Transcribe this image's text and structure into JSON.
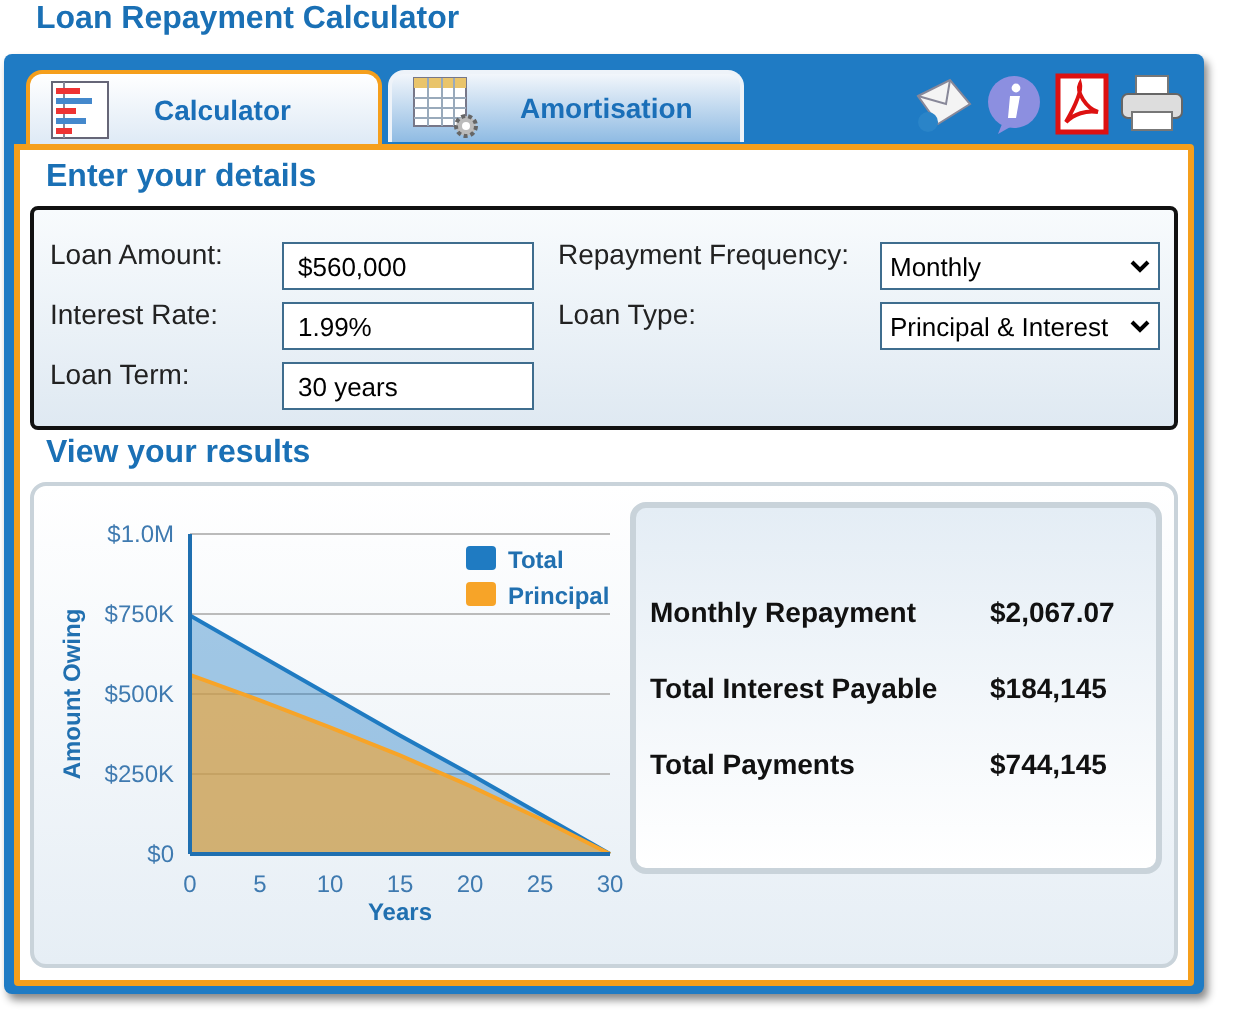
{
  "title": "Loan Repayment Calculator",
  "tabs": [
    {
      "label": "Calculator",
      "selected": true,
      "kind": "calculator"
    },
    {
      "label": "Amortisation",
      "selected": false,
      "kind": "schedule"
    }
  ],
  "details": {
    "heading": "Enter your details",
    "fields": [
      {
        "label": "Loan Amount:",
        "value": "$560,000"
      },
      {
        "label": "Interest Rate:",
        "value": "1.99%"
      },
      {
        "label": "Loan Term:",
        "value": "30 years"
      }
    ],
    "selects": [
      {
        "label": "Repayment Frequency:",
        "value": "Monthly"
      },
      {
        "label": "Loan Type:",
        "value": "Principal & Interest"
      }
    ]
  },
  "results": {
    "heading": "View your results",
    "chart_data": {
      "type": "area",
      "xlabel": "Years",
      "ylabel": "Amount Owing",
      "x": [
        0,
        5,
        10,
        15,
        20,
        25,
        30
      ],
      "xlim": [
        0,
        30
      ],
      "grid": true,
      "legend": true,
      "ylim": [
        0,
        1000000
      ],
      "xticks": [
        0,
        5,
        10,
        15,
        20,
        25,
        30
      ],
      "yticks": [
        {
          "value": 0,
          "label": "$0"
        },
        {
          "value": 250000,
          "label": "$250K"
        },
        {
          "value": 500000,
          "label": "$500K"
        },
        {
          "value": 750000,
          "label": "$750K"
        },
        {
          "value": 1000000,
          "label": "$1.0M"
        }
      ],
      "series": [
        {
          "name": "Total",
          "color": "#1f7bc2",
          "values": [
            745000,
            620000,
            495000,
            370000,
            250000,
            125000,
            0
          ]
        },
        {
          "name": "Principal",
          "color": "#f7a428",
          "values": [
            560000,
            480000,
            396000,
            308000,
            213000,
            110000,
            0
          ]
        }
      ]
    },
    "summary": [
      {
        "label": "Monthly Repayment",
        "value": "$2,067.07"
      },
      {
        "label": "Total Interest Payable",
        "value": "$184,145"
      },
      {
        "label": "Total Payments",
        "value": "$744,145"
      }
    ]
  }
}
